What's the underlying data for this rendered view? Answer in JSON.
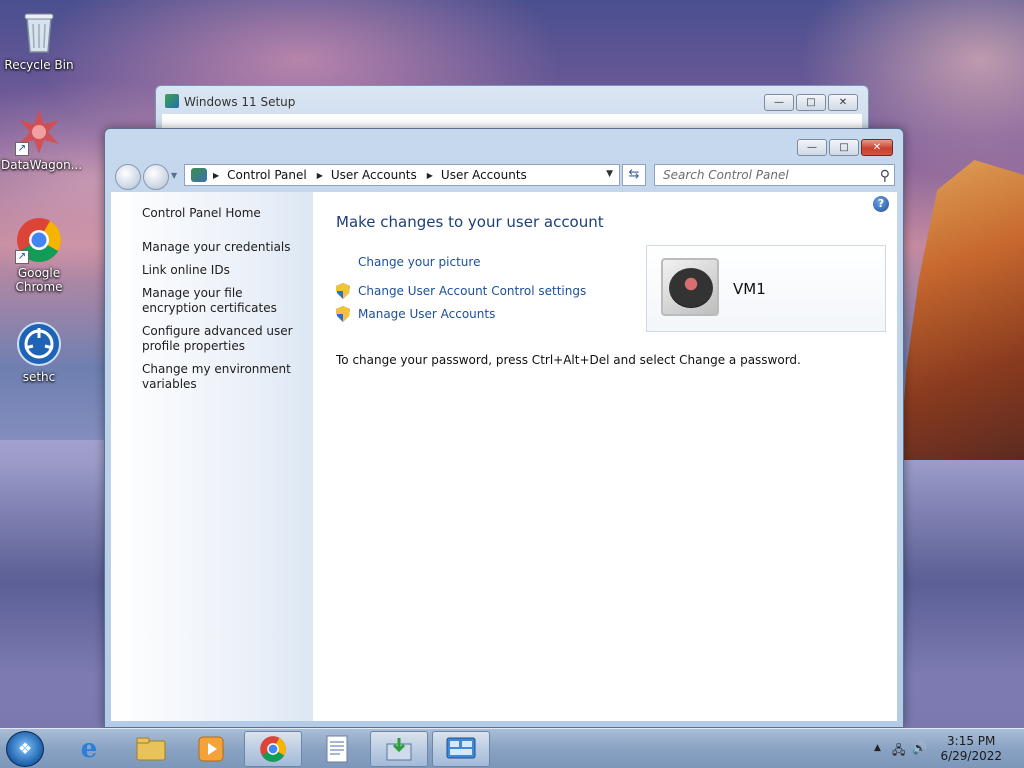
{
  "desktop": {
    "icons": [
      {
        "label": "Recycle Bin"
      },
      {
        "label": "DataWagon..."
      },
      {
        "label": "Google Chrome"
      },
      {
        "label": "sethc"
      }
    ]
  },
  "setup_window": {
    "title": "Windows 11 Setup"
  },
  "main_window": {
    "caption": {
      "minimize": "—",
      "maximize": "□",
      "close": "✕"
    },
    "address": {
      "crumbs": [
        "Control Panel",
        "User Accounts",
        "User Accounts"
      ]
    },
    "search": {
      "placeholder": "Search Control Panel"
    },
    "left_pane": {
      "home": "Control Panel Home",
      "tasks": [
        "Manage your credentials",
        "Link online IDs",
        "Manage your file encryption certificates",
        "Configure advanced user profile properties",
        "Change my environment variables"
      ]
    },
    "right_pane": {
      "title": "Make changes to your user account",
      "links": [
        "Change your picture",
        "Change User Account Control settings",
        "Manage User Accounts"
      ],
      "account_name": "VM1",
      "password_note": "To change your password, press Ctrl+Alt+Del and select Change a password."
    }
  },
  "taskbar": {
    "time": "3:15 PM",
    "date": "6/29/2022"
  },
  "colors": {
    "link": "#1d4f99",
    "title": "#1e3f7a",
    "close_button": "#c9412f"
  }
}
